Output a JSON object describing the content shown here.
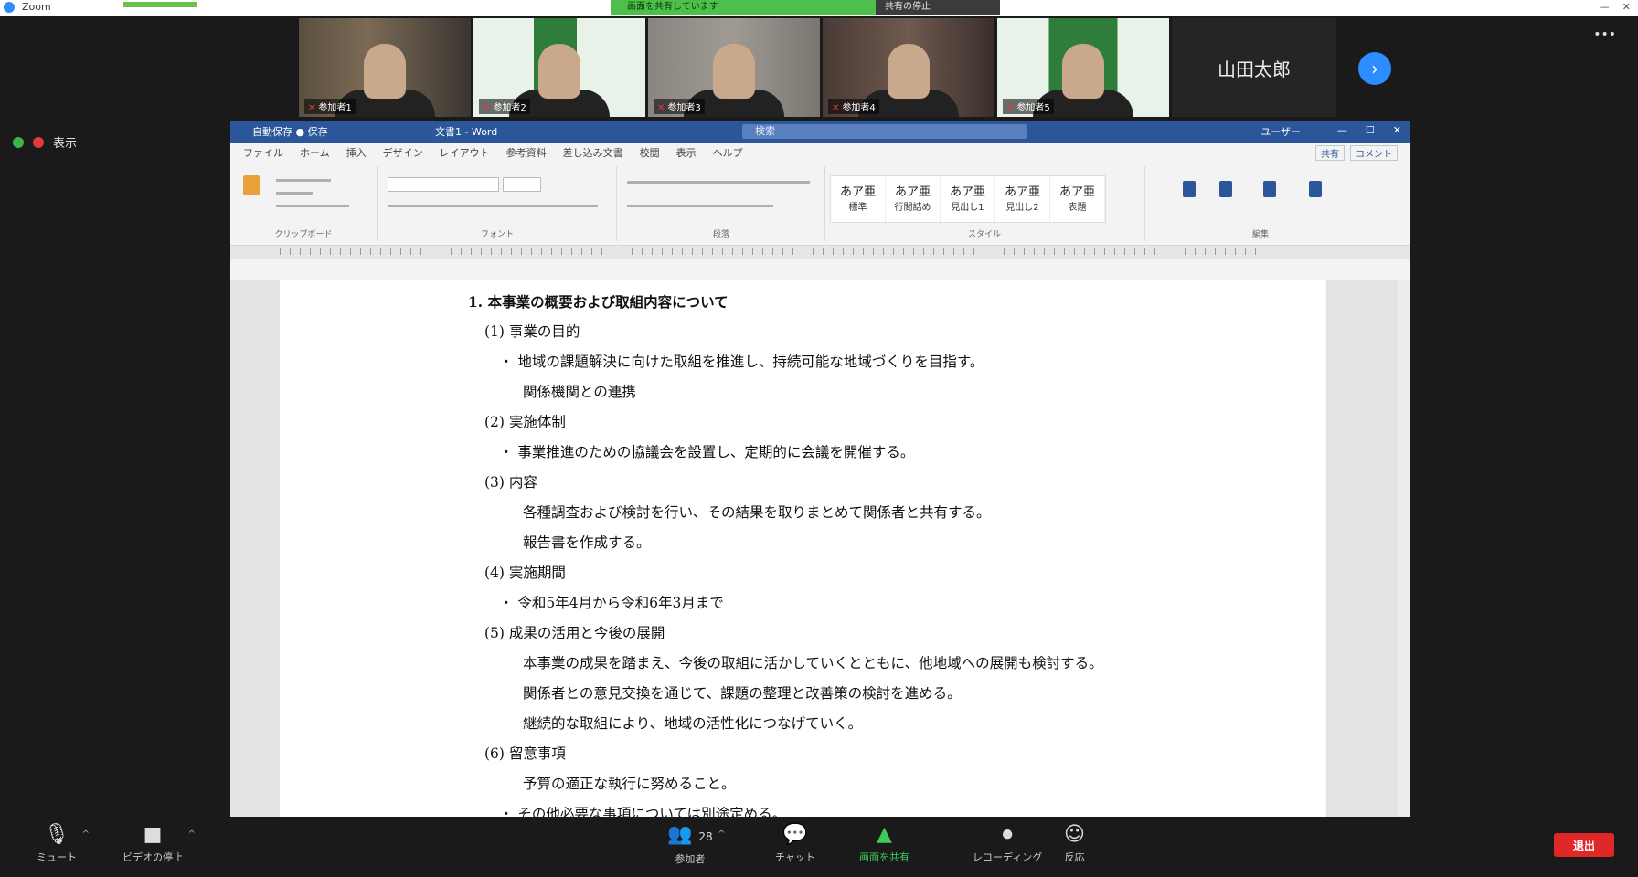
{
  "app": {
    "topbar_text": "Zoom",
    "share_banner": "画面を共有しています",
    "share_stop": "共有の停止"
  },
  "participants": [
    {
      "name": "参加者1"
    },
    {
      "name": "参加者2"
    },
    {
      "name": "参加者3"
    },
    {
      "name": "参加者4"
    },
    {
      "name": "参加者5"
    }
  ],
  "participant_name_tile": "山田太郎",
  "top_more": "•••",
  "status": {
    "view_label": "表示"
  },
  "word": {
    "quick_access": "自動保存 ● 保存",
    "title": "文書1 - Word",
    "search_placeholder": "検索",
    "user": "ユーザー",
    "tabs": [
      "ファイル",
      "ホーム",
      "挿入",
      "デザイン",
      "レイアウト",
      "参考資料",
      "差し込み文書",
      "校閲",
      "表示",
      "ヘルプ"
    ],
    "share_btn": "共有",
    "comment_btn": "コメント",
    "groups": {
      "clipboard": "クリップボード",
      "font": "フォント",
      "paragraph": "段落",
      "styles": "スタイル",
      "editing": "編集"
    },
    "styles": [
      "標準",
      "行間詰め",
      "見出し1",
      "見出し2",
      "表題"
    ],
    "doc_lines": [
      "1. 本事業の概要および取組内容について",
      "(1) 事業の目的",
      "・ 地域の課題解決に向けた取組を推進し、持続可能な地域づくりを目指す。",
      "   関係機関との連携",
      "(2) 実施体制",
      "・ 事業推進のための協議会を設置し、定期的に会議を開催する。",
      "(3) 内容",
      "   各種調査および検討を行い、その結果を取りまとめて関係者と共有する。",
      "   報告書を作成する。",
      "(4) 実施期間",
      "・ 令和5年4月から令和6年3月まで",
      "(5) 成果の活用と今後の展開",
      "   本事業の成果を踏まえ、今後の取組に活かしていくとともに、他地域への展開も検討する。",
      "   関係者との意見交換を通じて、課題の整理と改善策の検討を進める。",
      "   継続的な取組により、地域の活性化につなげていく。",
      "(6) 留意事項",
      "   予算の適正な執行に努めること。",
      "・ その他必要な事項については別途定める。"
    ]
  },
  "toolbar": {
    "mute": "ミュート",
    "video": "ビデオの停止",
    "participants": "参加者",
    "participants_count": "28",
    "chat": "チャット",
    "share": "画面を共有",
    "record": "レコーディング",
    "reactions": "反応",
    "end": "退出"
  }
}
